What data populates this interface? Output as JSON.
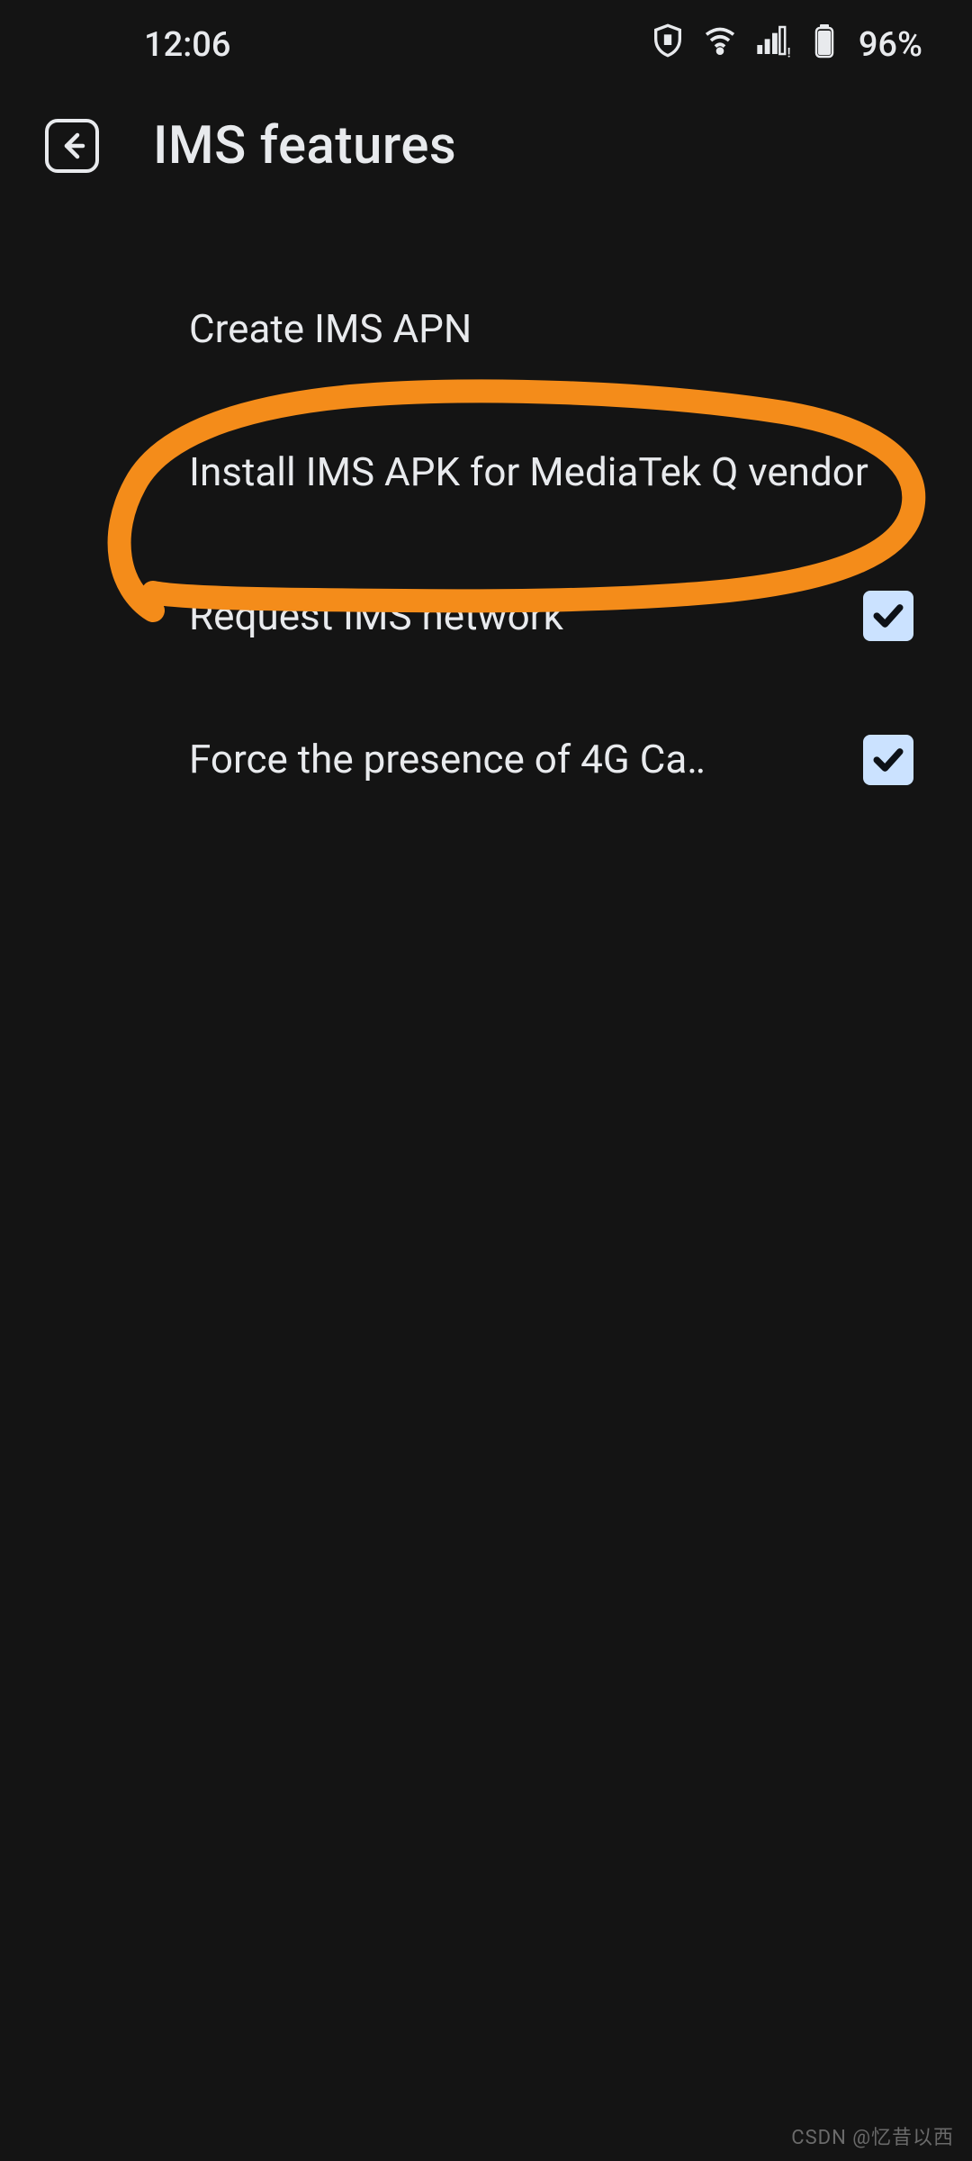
{
  "status": {
    "time": "12:06",
    "battery_pct": "96%"
  },
  "header": {
    "title": "IMS features"
  },
  "items": [
    {
      "label": "Create IMS APN",
      "has_checkbox": false
    },
    {
      "label": "Install IMS APK for MediaTek Q vendor",
      "has_checkbox": false
    },
    {
      "label": "Request IMS network",
      "has_checkbox": true,
      "checked": true
    },
    {
      "label": "Force the presence of 4G Ca‥",
      "has_checkbox": true,
      "checked": true
    }
  ],
  "annotation": {
    "color": "#f48c1a",
    "circled_item_index": 1
  },
  "watermark": "CSDN @忆昔以西"
}
